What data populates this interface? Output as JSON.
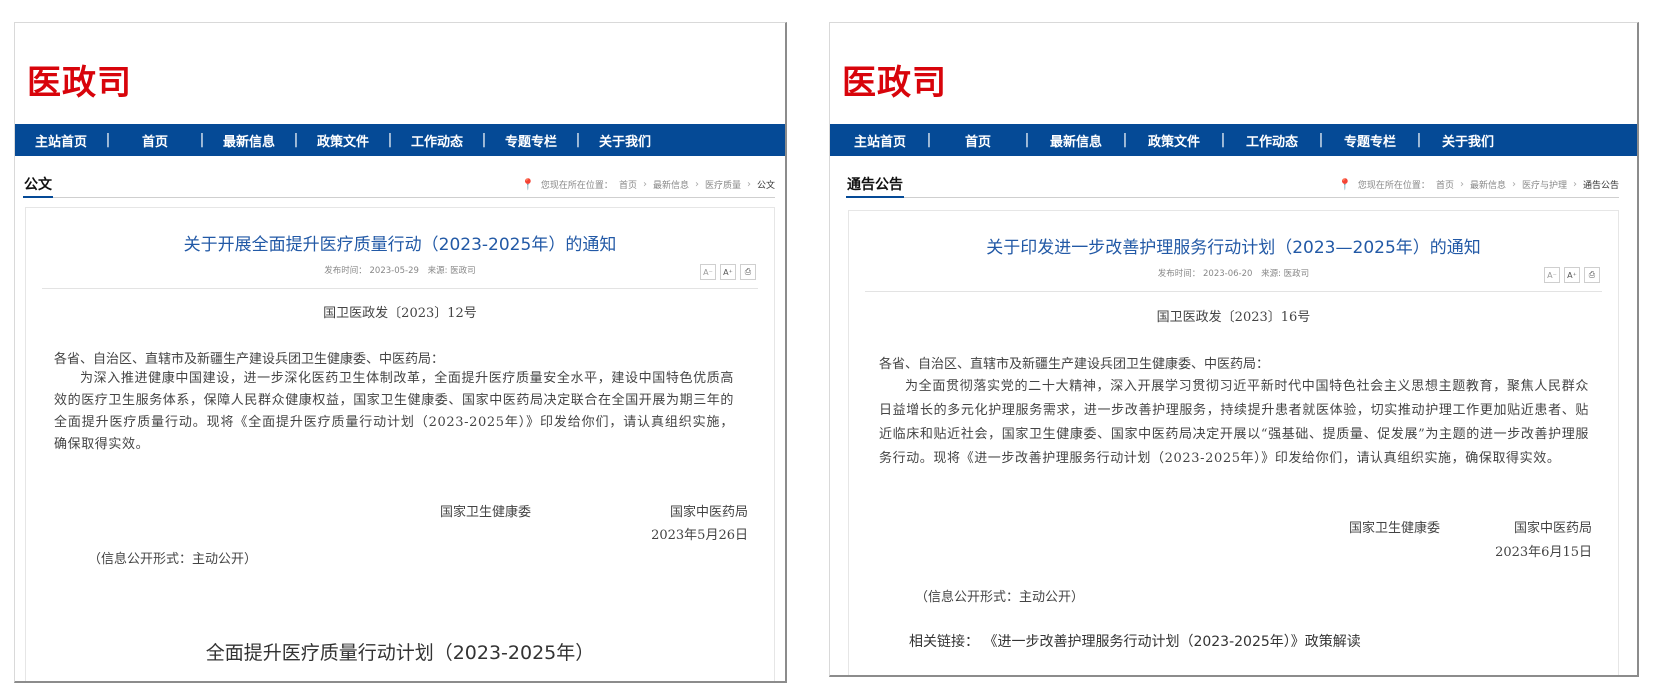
{
  "site": {
    "logo": "医政司"
  },
  "nav": [
    {
      "label": "主站首页"
    },
    {
      "label": "首页"
    },
    {
      "label": "最新信息"
    },
    {
      "label": "政策文件"
    },
    {
      "label": "工作动态"
    },
    {
      "label": "专题专栏"
    },
    {
      "label": "关于我们"
    }
  ],
  "nav_separator": "|",
  "left": {
    "section": "公文",
    "breadcrumb": {
      "prefix": "您现在所在位置：",
      "items": [
        "首页",
        "最新信息",
        "医疗质量",
        "公文"
      ]
    },
    "title": "关于开展全面提升医疗质量行动（2023-2025年）的通知",
    "meta": {
      "date": "发布时间：  2023-05-29",
      "source": "来源: 医政司"
    },
    "doc_number": "国卫医政发〔2023〕12号",
    "salutation": "各省、自治区、直辖市及新疆生产建设兵团卫生健康委、中医药局：",
    "body": "为深入推进健康中国建设，进一步深化医药卫生体制改革，全面提升医疗质量安全水平，建设中国特色优质高效的医疗卫生服务体系，保障人民群众健康权益，国家卫生健康委、国家中医药局决定联合在全国开展为期三年的全面提升医疗质量行动。现将《全面提升医疗质量行动计划（2023-2025年）》印发给你们，请认真组织实施，确保取得实效。",
    "signers": [
      "国家卫生健康委",
      "国家中医药局"
    ],
    "date": "2023年5月26日",
    "disclosure": "（信息公开形式：主动公开）",
    "attachment_title": "全面提升医疗质量行动计划（2023-2025年）"
  },
  "right": {
    "section": "通告公告",
    "breadcrumb": {
      "prefix": "您现在所在位置：",
      "items": [
        "首页",
        "最新信息",
        "医疗与护理",
        "通告公告"
      ]
    },
    "title": "关于印发进一步改善护理服务行动计划（2023—2025年）的通知",
    "meta": {
      "date": "发布时间：  2023-06-20",
      "source": "来源: 医政司"
    },
    "doc_number": "国卫医政发〔2023〕16号",
    "salutation": "各省、自治区、直辖市及新疆生产建设兵团卫生健康委、中医药局：",
    "body": "为全面贯彻落实党的二十大精神，深入开展学习贯彻习近平新时代中国特色社会主义思想主题教育，聚焦人民群众日益增长的多元化护理服务需求，进一步改善护理服务，持续提升患者就医体验，切实推动护理工作更加贴近患者、贴近临床和贴近社会，国家卫生健康委、国家中医药局决定开展以“强基础、提质量、促发展”为主题的进一步改善护理服务行动。现将《进一步改善护理服务行动计划（2023-2025年）》印发给你们，请认真组织实施，确保取得实效。",
    "signers": [
      "国家卫生健康委",
      "国家中医药局"
    ],
    "date": "2023年6月15日",
    "disclosure": "（信息公开形式：主动公开）",
    "related": {
      "label": "相关链接：",
      "title": "《进一步改善护理服务行动计划（2023-2025年）》政策解读"
    }
  },
  "tools": {
    "font_decrease": "A⁻",
    "font_increase": "A⁺",
    "print": "⎙"
  },
  "icons": {
    "location": "location-pin-icon",
    "print": "printer-icon"
  },
  "colors": {
    "logo": "#d8040b",
    "nav_bg": "#054a96",
    "title": "#2259a6"
  }
}
